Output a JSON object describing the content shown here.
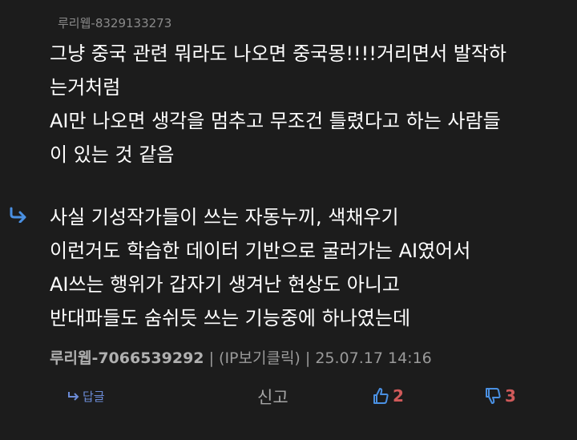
{
  "parent_comment": {
    "author": "루리웹-8329133273",
    "lines": [
      "그냥 중국 관련 뭐라도 나오면 중국몽!!!!거리면서 발작하",
      "는거처럼",
      "AI만 나오면 생각을 멈추고 무조건 틀렸다고 하는 사람들",
      "이 있는 것 같음"
    ]
  },
  "reply": {
    "icon": "reply-arrow-icon",
    "lines": [
      "사실 기성작가들이 쓰는 자동누끼, 색채우기",
      "이런거도 학습한 데이터 기반으로 굴러가는 AI였어서",
      "AI쓰는 행위가 갑자기 생겨난 현상도 아니고",
      "반대파들도 숨쉬듯 쓰는 기능중에 하나였는데"
    ],
    "author": "루리웹-7066539292",
    "separator": "|",
    "ip_label": "(IP보기클릭)",
    "timestamp": "25.07.17 14:16"
  },
  "actions": {
    "reply_label": "답글",
    "report_label": "신고",
    "like_count": "2",
    "dislike_count": "3"
  },
  "colors": {
    "background": "#1c1c1c",
    "accent_blue": "#4a90e2",
    "accent_red": "#d05a5a"
  }
}
